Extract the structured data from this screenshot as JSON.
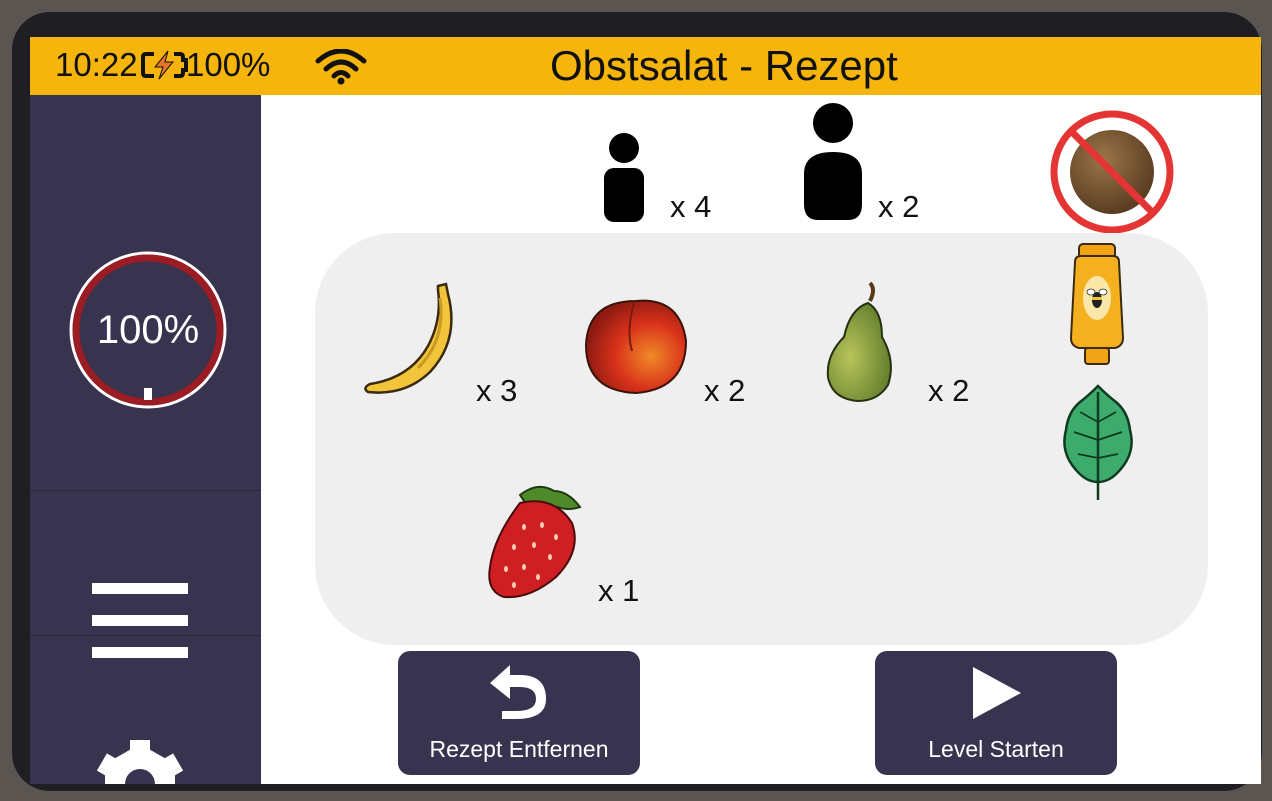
{
  "status_bar": {
    "time": "10:22",
    "battery": "100%",
    "battery_icon": "charging-battery-icon",
    "wifi_icon": "wifi-icon",
    "background_color": "#f6b50d"
  },
  "title": "Obstsalat - Rezept",
  "sidebar": {
    "progress_label": "100%",
    "progress_value": 1.0,
    "menu_icon": "hamburger-menu-icon",
    "settings_icon": "gear-icon",
    "background_color": "#38334f"
  },
  "servings": [
    {
      "icon": "child-person-icon",
      "quantity": "x 4"
    },
    {
      "icon": "adult-person-icon",
      "quantity": "x 2"
    }
  ],
  "restriction_icon": "no-nuts-icon",
  "ingredients": [
    {
      "icon": "banana-icon",
      "quantity": "x 3"
    },
    {
      "icon": "peach-icon",
      "quantity": "x 2"
    },
    {
      "icon": "pear-icon",
      "quantity": "x 2"
    },
    {
      "icon": "strawberry-icon",
      "quantity": "x 1"
    }
  ],
  "extras": [
    {
      "icon": "honey-bottle-icon"
    },
    {
      "icon": "mint-leaf-icon"
    }
  ],
  "buttons": {
    "remove_label": "Rezept Entfernen",
    "remove_icon": "undo-arrow-icon",
    "start_label": "Level Starten",
    "start_icon": "play-icon"
  }
}
